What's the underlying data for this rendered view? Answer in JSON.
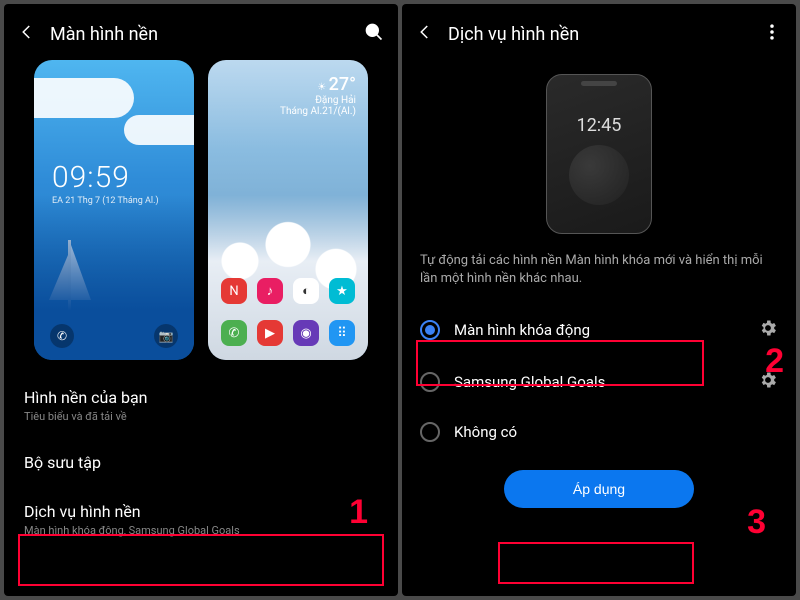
{
  "screen1": {
    "title": "Màn hình nền",
    "lock_preview": {
      "time": "09:59",
      "date": "EA 21 Thg 7 (12 Tháng Al.)"
    },
    "home_preview": {
      "temp": "27°",
      "location": "Đặng Hải",
      "sub": "Tháng Al.21/(Al.)"
    },
    "section_yours": {
      "title": "Hình nền của bạn",
      "sub": "Tiêu biểu và đã tải về"
    },
    "section_gallery": {
      "title": "Bộ sưu tập"
    },
    "section_service": {
      "title": "Dịch vụ hình nền",
      "sub": "Màn hình khóa động, Samsung Global Goals"
    }
  },
  "screen2": {
    "title": "Dịch vụ hình nền",
    "mini_time": "12:45",
    "desc": "Tự động tải các hình nền Màn hình khóa mới và hiển thị mỗi lần một hình nền khác nhau.",
    "options": [
      {
        "label": "Màn hình khóa động",
        "checked": true,
        "gear": true
      },
      {
        "label": "Samsung Global Goals",
        "checked": false,
        "gear": true
      },
      {
        "label": "Không có",
        "checked": false,
        "gear": false
      }
    ],
    "apply": "Áp dụng"
  },
  "annotations": {
    "n1": "1",
    "n2": "2",
    "n3": "3"
  }
}
